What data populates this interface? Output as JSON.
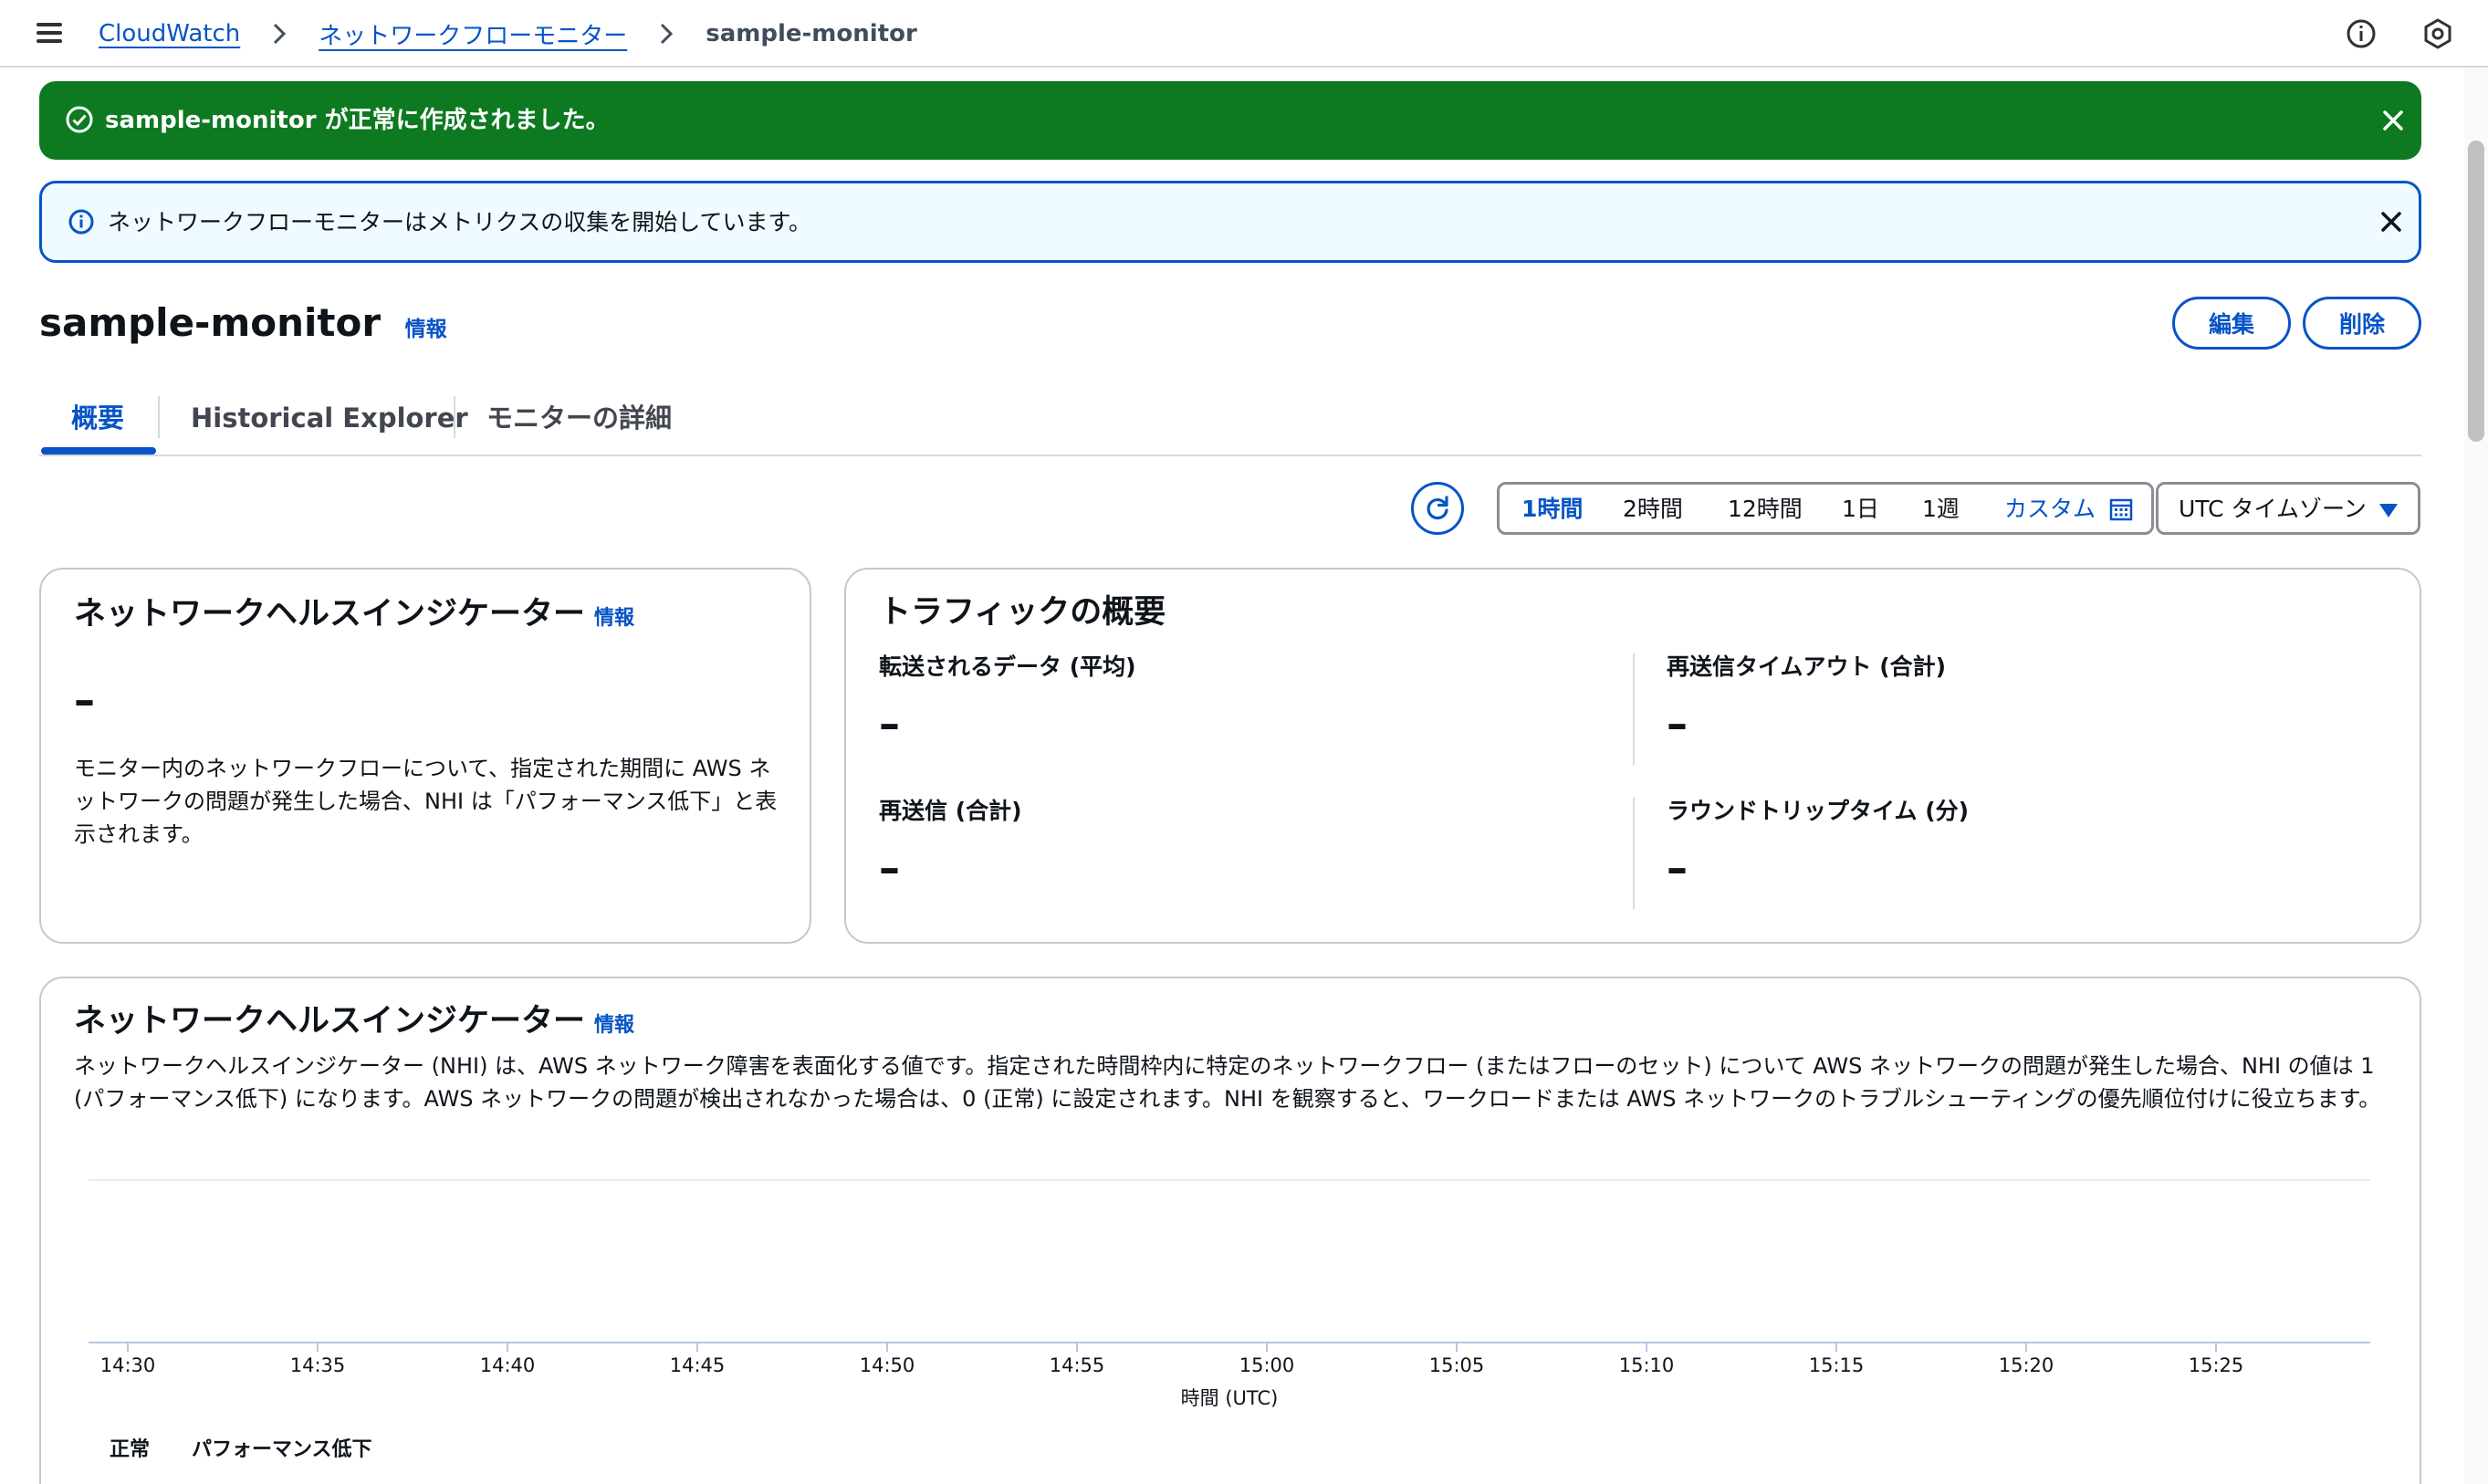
{
  "nav": {
    "breadcrumbs": [
      "CloudWatch",
      "ネットワークフローモニター"
    ],
    "current": "sample-monitor",
    "icons": [
      "menu-icon",
      "info-circle-icon",
      "settings-hex-icon"
    ]
  },
  "flash": {
    "success_message": "sample-monitor が正常に作成されました。",
    "info_message": "ネットワークフローモニターはメトリクスの収集を開始しています。"
  },
  "header": {
    "title": "sample-monitor",
    "info_label": "情報",
    "edit_label": "編集",
    "delete_label": "削除"
  },
  "tabs": [
    "概要",
    "Historical Explorer",
    "モニターの詳細"
  ],
  "controls": {
    "ranges": [
      "1時間",
      "2時間",
      "12時間",
      "1日",
      "1週"
    ],
    "active_range": "1時間",
    "custom_label": "カスタム",
    "timezone_label": "UTC タイムゾーン"
  },
  "nhi_card": {
    "title": "ネットワークヘルスインジケーター",
    "info_label": "情報",
    "value": "–",
    "description": "モニター内のネットワークフローについて、指定された期間に AWS ネットワークの問題が発生した場合、NHI は「パフォーマンス低下」と表示されます。"
  },
  "traffic_card": {
    "title": "トラフィックの概要",
    "metrics": [
      {
        "label": "転送されるデータ (平均)",
        "value": "–"
      },
      {
        "label": "再送信タイムアウト (合計)",
        "value": "–"
      },
      {
        "label": "再送信 (合計)",
        "value": "–"
      },
      {
        "label": "ラウンドトリップタイム (分)",
        "value": "–"
      }
    ]
  },
  "chart_card": {
    "title": "ネットワークヘルスインジケーター",
    "info_label": "情報",
    "description": "ネットワークヘルスインジケーター (NHI) は、AWS ネットワーク障害を表面化する値です。指定された時間枠内に特定のネットワークフロー (またはフローのセット) について AWS ネットワークの問題が発生した場合、NHI の値は 1 (パフォーマンス低下) になります。AWS ネットワークの問題が検出されなかった場合は、0 (正常) に設定されます。NHI を観察すると、ワークロードまたは AWS ネットワークのトラブルシューティングの優先順位付けに役立ちます。"
  },
  "chart_data": {
    "type": "line",
    "x": [
      "14:30",
      "14:35",
      "14:40",
      "14:45",
      "14:50",
      "14:55",
      "15:00",
      "15:05",
      "15:10",
      "15:15",
      "15:20",
      "15:25"
    ],
    "xlabel": "時間 (UTC)",
    "ylabel": "",
    "series": [
      {
        "name": "正常",
        "values": []
      },
      {
        "name": "パフォーマンス低下",
        "values": []
      }
    ],
    "legend": [
      "正常",
      "パフォーマンス低下"
    ],
    "legend_position": "bottom-left",
    "grid": false
  }
}
